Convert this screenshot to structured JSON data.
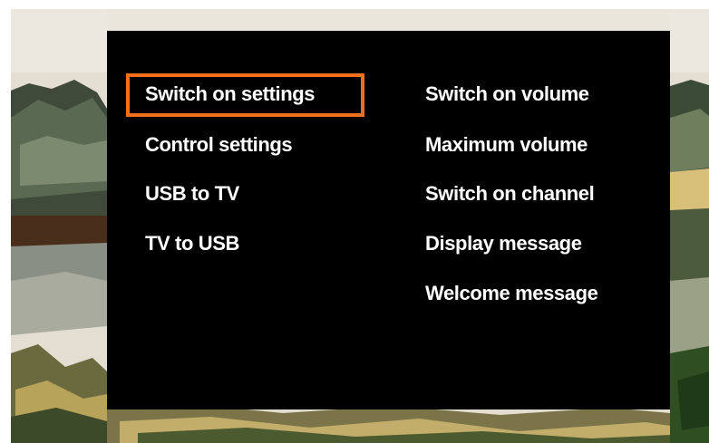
{
  "menu": {
    "left_column": [
      {
        "label": "Switch on settings",
        "selected": true
      },
      {
        "label": "Control settings",
        "selected": false
      },
      {
        "label": "USB to TV",
        "selected": false
      },
      {
        "label": "TV to USB",
        "selected": false
      }
    ],
    "right_column": [
      {
        "label": "Switch on volume",
        "selected": false
      },
      {
        "label": "Maximum volume",
        "selected": false
      },
      {
        "label": "Switch on channel",
        "selected": false
      },
      {
        "label": "Display message",
        "selected": false
      },
      {
        "label": "Welcome message",
        "selected": false
      }
    ]
  },
  "colors": {
    "panel_background": "#000000",
    "text": "#ffffff",
    "focus_highlight": "#f26f1c"
  }
}
